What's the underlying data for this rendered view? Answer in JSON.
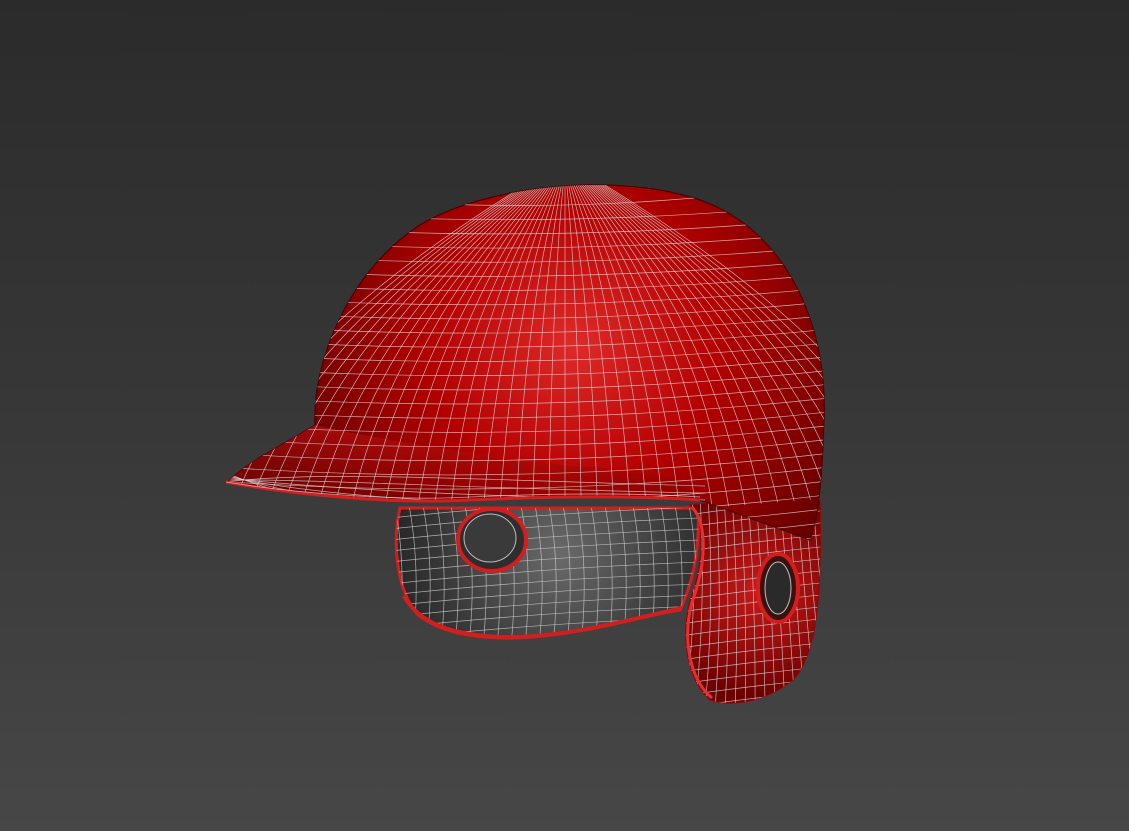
{
  "viewport": {
    "background_top": "#2b2b2b",
    "background_bottom": "#474747"
  },
  "model": {
    "object": "baseball-batting-helmet",
    "display_mode": "shaded-with-wireframe",
    "shell_color": "#b30000",
    "shell_highlight": "#e02a2a",
    "shell_shadow": "#5c0000",
    "liner_color": "#2a2a2a",
    "liner_highlight": "#6a6a6a",
    "trim_color": "#d41e1e",
    "wire_color": "#d8d8d8"
  }
}
